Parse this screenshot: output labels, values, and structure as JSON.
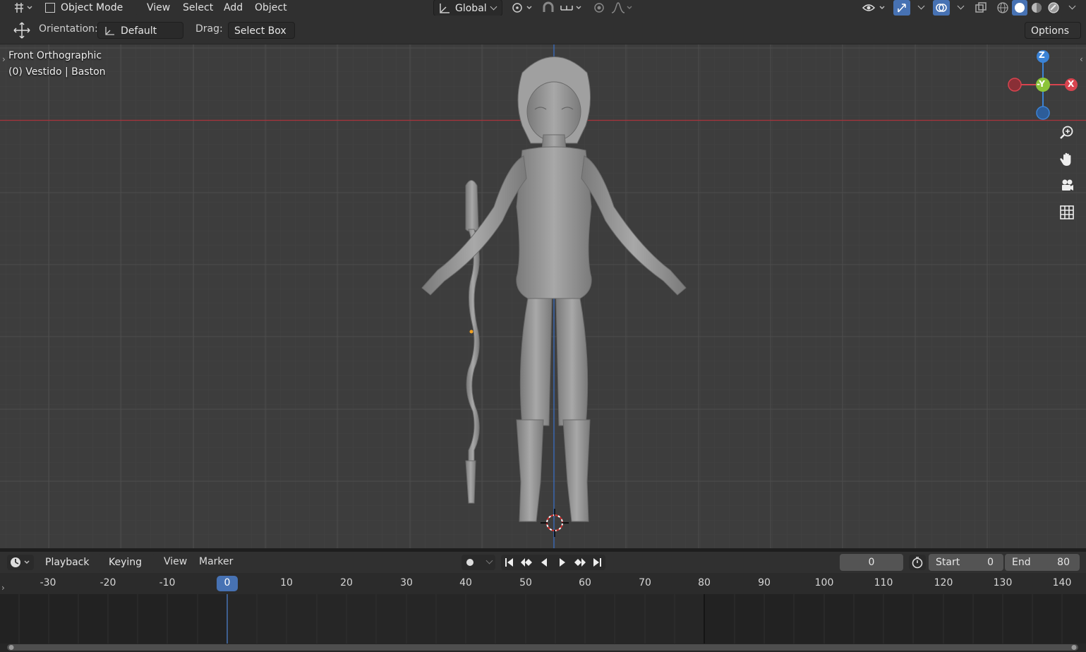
{
  "header": {
    "mode_label": "Object Mode",
    "menu": [
      "View",
      "Select",
      "Add",
      "Object"
    ],
    "transform_orientation": "Global"
  },
  "tool_header": {
    "orientation_label": "Orientation:",
    "orientation_value": "Default",
    "drag_label": "Drag:",
    "drag_value": "Select Box",
    "options_label": "Options"
  },
  "viewport": {
    "view_name": "Front Orthographic",
    "object_info": "(0) Vestido | Baston",
    "gizmo": {
      "z": "Z",
      "y": "-Y",
      "x": "X"
    }
  },
  "timeline": {
    "menu": [
      "Playback",
      "Keying",
      "View",
      "Marker"
    ],
    "current_frame": "0",
    "start_label": "Start",
    "start_value": "0",
    "end_label": "End",
    "end_value": "80",
    "ruler": [
      "-30",
      "-20",
      "-10",
      "0",
      "10",
      "20",
      "30",
      "40",
      "50",
      "60",
      "70",
      "80",
      "90",
      "100",
      "110",
      "120",
      "130",
      "140"
    ],
    "playhead": "0"
  },
  "colors": {
    "x_axis": "#d8444f",
    "y_axis": "#8cc43a",
    "z_axis": "#3b83d6",
    "accent": "#4772b3"
  }
}
